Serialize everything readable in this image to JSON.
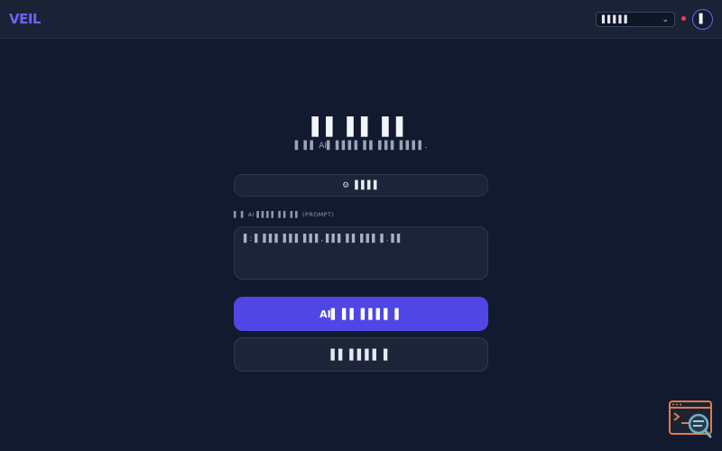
{
  "header": {
    "logo": "VEIL",
    "language_select": {
      "value": "▌▌▌▌▌",
      "options": [
        "▌▌▌▌▌"
      ]
    },
    "status_dot_color": "#ef4444",
    "avatar_initial": "▌"
  },
  "main": {
    "title": "▌▌ ▌▌ ▌▌",
    "subtitle": "▌ ▌▌ AI▌ ▌▌▌▌ ▌▌ ▌▌▌ ▌▌▌▌.",
    "settings_button": {
      "icon": "gear-icon",
      "label": "▌▌▌▌"
    },
    "prompt": {
      "label": "▌ ▌ AI ▌▌▌▌ ▌▌ ▌▌ (PROMPT)",
      "placeholder": "▌: ▌ ▌▌▌ ▌▌▌ ▌▌▌, ▌▌▌ ▌▌ ▌▌▌ ▌. ▌▌"
    },
    "primary_button_label": "AI▌ ▌▌ ▌▌▌▌ ▌",
    "secondary_button_label": "▌▌ ▌▌▌▌ ▌"
  },
  "colors": {
    "background": "#111a2e",
    "accent": "#4f46e5",
    "logo": "#6d63f2"
  },
  "floating_widget": {
    "icon": "terminal-search-icon"
  }
}
